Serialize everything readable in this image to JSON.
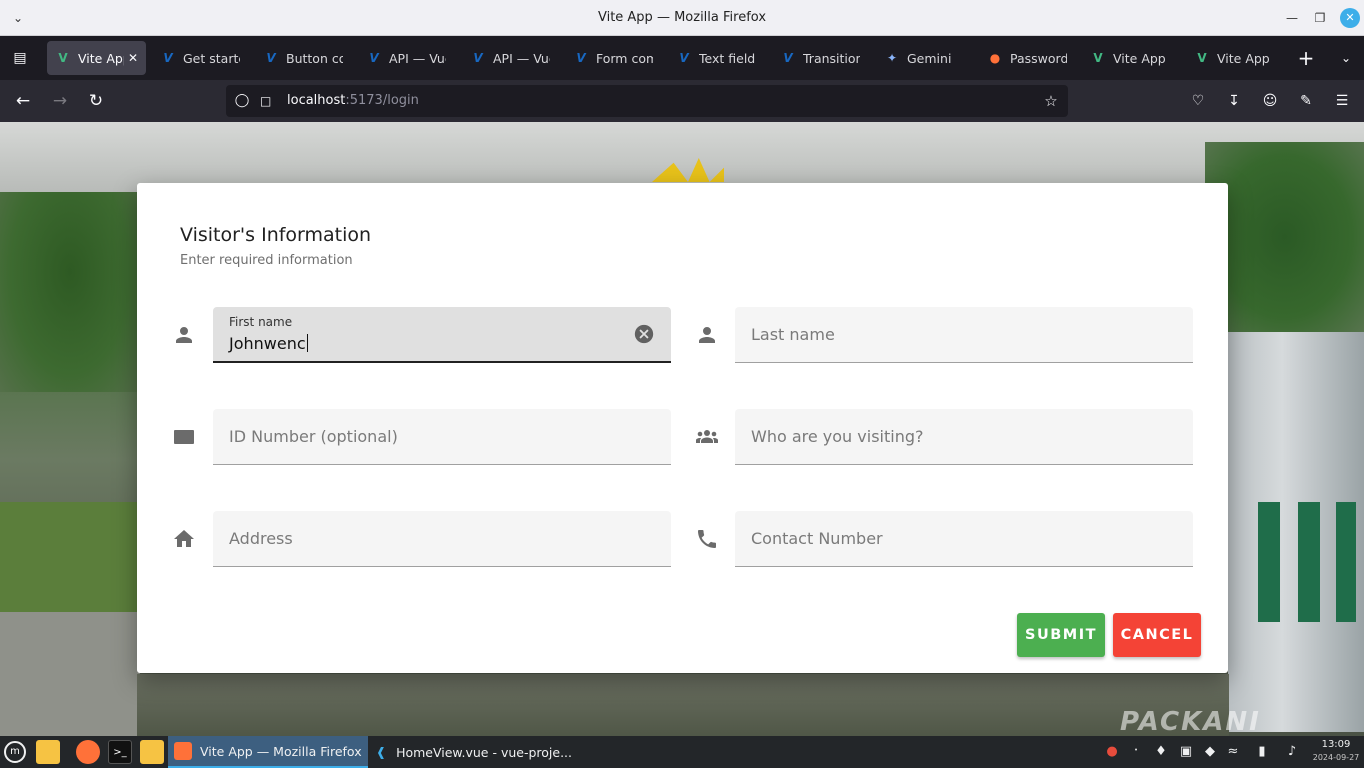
{
  "window": {
    "title": "Vite App — Mozilla Firefox"
  },
  "tabs": [
    {
      "label": "Vite App",
      "icon": "vue-icon",
      "active": true
    },
    {
      "label": "Get started",
      "icon": "vuetify-icon"
    },
    {
      "label": "Button comp",
      "icon": "vuetify-icon"
    },
    {
      "label": "API — Vue",
      "icon": "vuetify-icon"
    },
    {
      "label": "API — Vue",
      "icon": "vuetify-icon"
    },
    {
      "label": "Form comp",
      "icon": "vuetify-icon"
    },
    {
      "label": "Text field",
      "icon": "vuetify-icon"
    },
    {
      "label": "Transition",
      "icon": "vuetify-icon"
    },
    {
      "label": "Gemini",
      "icon": "gemini-icon"
    },
    {
      "label": "Password",
      "icon": "firefox-icon"
    },
    {
      "label": "Vite App",
      "icon": "vue-icon"
    },
    {
      "label": "Vite App",
      "icon": "vue-icon"
    }
  ],
  "address_bar": {
    "host": "localhost",
    "path": ":5173/login"
  },
  "dialog": {
    "title": "Visitor's Information",
    "subtitle": "Enter required information",
    "fields": {
      "first_name": {
        "label": "First name",
        "value": "Johnwenc",
        "icon": "person-icon"
      },
      "last_name": {
        "placeholder": "Last name",
        "icon": "person-icon"
      },
      "id_number": {
        "placeholder": "ID Number (optional)",
        "icon": "card-icon"
      },
      "visiting": {
        "placeholder": "Who are you visiting?",
        "icon": "group-icon"
      },
      "address": {
        "placeholder": "Address",
        "icon": "home-icon"
      },
      "contact": {
        "placeholder": "Contact Number",
        "icon": "phone-icon"
      }
    },
    "buttons": {
      "submit": "SUBMIT",
      "cancel": "CANCEL"
    },
    "colors": {
      "submit": "#4caf50",
      "cancel": "#f44336"
    }
  },
  "background": {
    "watermark": "PACKANI"
  },
  "taskbar": {
    "tasks": [
      {
        "label": "Vite App — Mozilla Firefox",
        "active": true
      },
      {
        "label": "HomeView.vue - vue-proje..."
      }
    ],
    "clock": {
      "time": "13:09",
      "date": "2024-09-27"
    }
  }
}
